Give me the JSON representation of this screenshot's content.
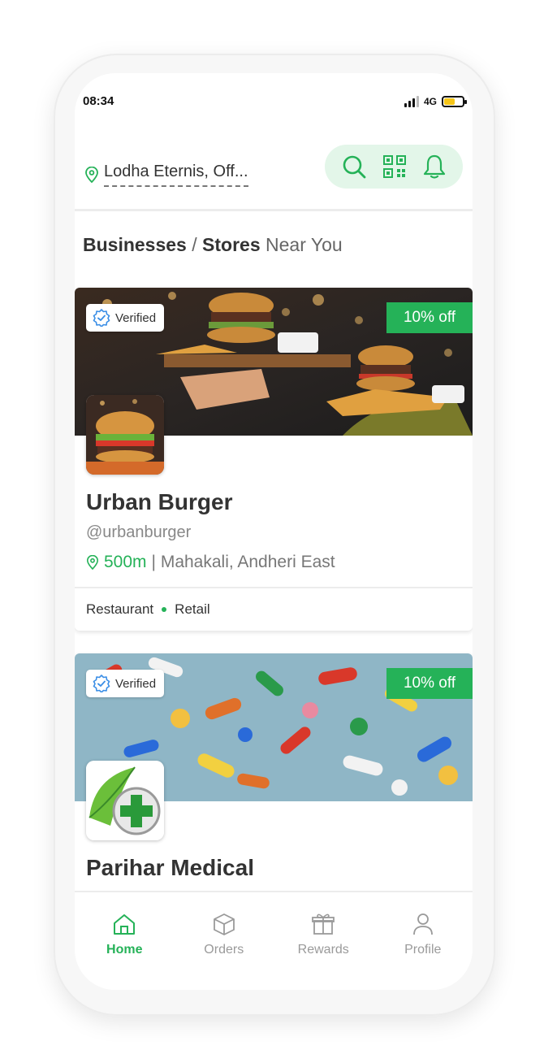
{
  "status_bar": {
    "time": "08:34",
    "network": "4G",
    "battery_level": 0.6
  },
  "header": {
    "location": "Lodha Eternis, Off..."
  },
  "section": {
    "title_bold_1": "Businesses",
    "separator": " / ",
    "title_bold_2": "Stores",
    "title_light": " Near You"
  },
  "businesses": [
    {
      "verified_label": "Verified",
      "discount": "10% off",
      "name": "Urban Burger",
      "handle": "@urbanburger",
      "distance": "500m",
      "address": "| Mahakali, Andheri East",
      "categories": [
        "Restaurant",
        "Retail"
      ]
    },
    {
      "verified_label": "Verified",
      "discount": "10% off",
      "name": "Parihar Medical"
    }
  ],
  "bottom_nav": [
    {
      "label": "Home",
      "icon": "home-icon",
      "active": true
    },
    {
      "label": "Orders",
      "icon": "box-icon",
      "active": false
    },
    {
      "label": "Rewards",
      "icon": "gift-icon",
      "active": false
    },
    {
      "label": "Profile",
      "icon": "user-icon",
      "active": false
    }
  ],
  "colors": {
    "accent": "#25b258",
    "action_bg": "#e3f6e9"
  }
}
